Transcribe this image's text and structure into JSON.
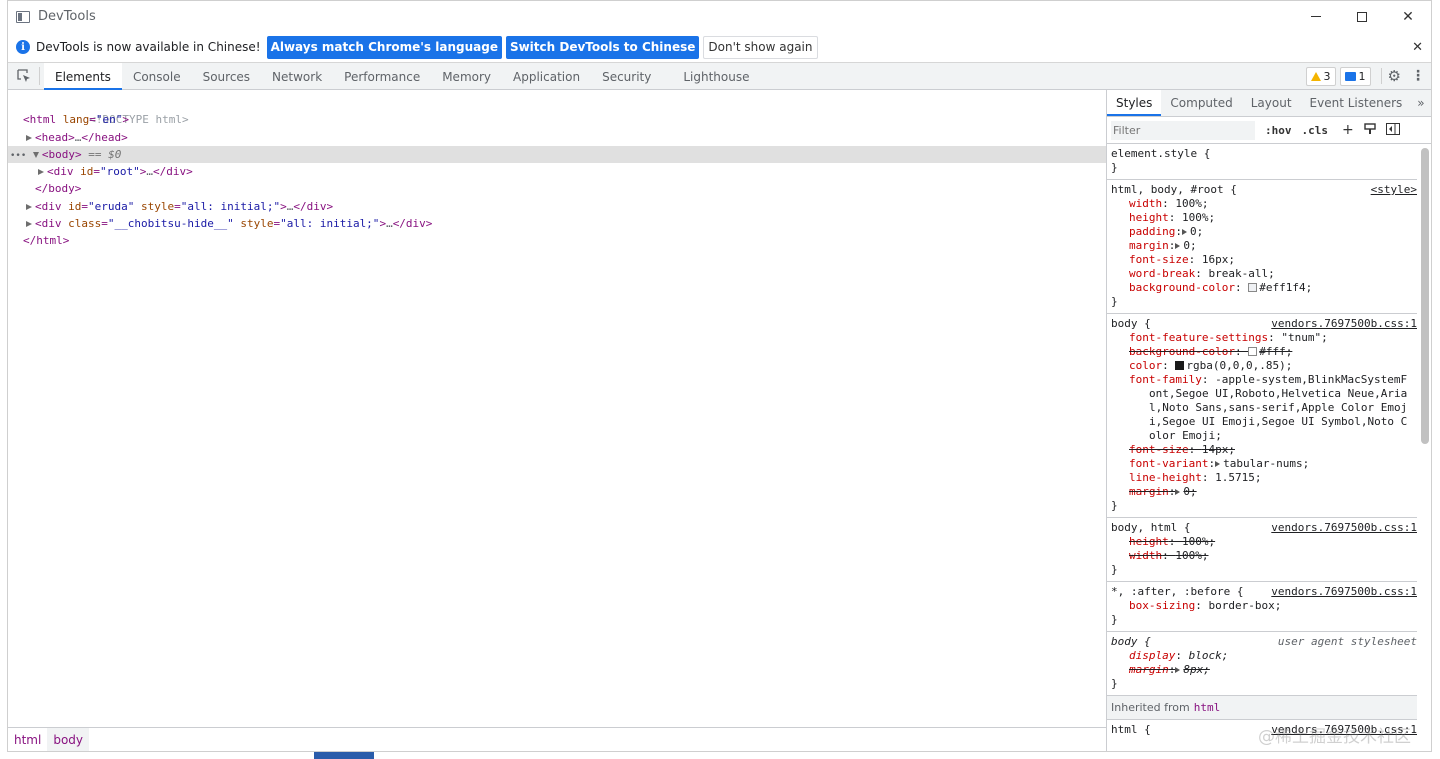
{
  "window": {
    "title": "DevTools",
    "minimize": "—",
    "maximize": "☐",
    "close": "✕"
  },
  "infobar": {
    "message": "DevTools is now available in Chinese!",
    "btn_match": "Always match Chrome's language",
    "btn_switch": "Switch DevTools to Chinese",
    "btn_dismiss": "Don't show again",
    "close": "✕"
  },
  "toolbar": {
    "tabs": [
      "Elements",
      "Console",
      "Sources",
      "Network",
      "Performance",
      "Memory",
      "Application",
      "Security",
      "Lighthouse"
    ],
    "active_tab": "Elements",
    "warnings_count": "3",
    "messages_count": "1"
  },
  "dom": {
    "doctype": "<!DOCTYPE html>",
    "html_open": "<html",
    "html_lang_attr": "lang",
    "html_lang_val": "\"en\"",
    "head": "<head>",
    "head_close": "</head>",
    "body_open": "<body>",
    "body_suffix": "== $0",
    "root_open": "<div",
    "root_id_attr": "id",
    "root_id_val": "\"root\"",
    "div_close": "</div>",
    "body_close": "</body>",
    "eruda_id_val": "\"eruda\"",
    "style_attr": "style",
    "style_val": "\"all: initial;\"",
    "class_attr": "class",
    "chobitsu_val": "\"__chobitsu-hide__\"",
    "html_close": "</html>",
    "ellipsis": "…",
    "dots": "•••"
  },
  "breadcrumbs": [
    "html",
    "body"
  ],
  "styles_tabs": {
    "items": [
      "Styles",
      "Computed",
      "Layout",
      "Event Listeners"
    ],
    "more": "»"
  },
  "filter": {
    "placeholder": "Filter",
    "hov": ":hov",
    "cls": ".cls",
    "plus": "+"
  },
  "rules": {
    "element_style": {
      "selector": "element.style {",
      "close": "}"
    },
    "r1": {
      "selector": "html, body, #root {",
      "source": "<style>",
      "decls": [
        {
          "p": "width",
          "v": "100%;"
        },
        {
          "p": "height",
          "v": "100%;"
        },
        {
          "p": "padding",
          "v": "0;"
        },
        {
          "p": "margin",
          "v": "0;"
        },
        {
          "p": "font-size",
          "v": "16px;"
        },
        {
          "p": "word-break",
          "v": "break-all;"
        },
        {
          "p": "background-color",
          "v": "#eff1f4;"
        }
      ],
      "swatch_color": "#eff1f4"
    },
    "r2": {
      "selector": "body {",
      "source": "vendors.7697500b.css:1",
      "decls": [
        {
          "p": "font-feature-settings",
          "v": "\"tnum\";"
        },
        {
          "p": "background-color",
          "v": "#fff;"
        },
        {
          "p": "color",
          "v": "rgba(0,0,0,.85);"
        },
        {
          "p": "font-family",
          "v": "-apple-system,BlinkMacSystemFont,Segoe UI,Roboto,Helvetica Neue,Arial,Noto Sans,sans-serif,Apple Color Emoji,Segoe UI Emoji,Segoe UI Symbol,Noto Color Emoji;"
        },
        {
          "p": "font-size",
          "v": "14px;"
        },
        {
          "p": "font-variant",
          "v": "tabular-nums;"
        },
        {
          "p": "line-height",
          "v": "1.5715;"
        },
        {
          "p": "margin",
          "v": "0;"
        }
      ]
    },
    "r3": {
      "selector": "body, html {",
      "source": "vendors.7697500b.css:1",
      "decls": [
        {
          "p": "height",
          "v": "100%;"
        },
        {
          "p": "width",
          "v": "100%;"
        }
      ]
    },
    "r4": {
      "selector": "*, :after, :before {",
      "source": "vendors.7697500b.css:1",
      "decls": [
        {
          "p": "box-sizing",
          "v": "border-box;"
        }
      ]
    },
    "r5": {
      "selector": "body {",
      "source": "user agent stylesheet",
      "decls": [
        {
          "p": "display",
          "v": "block;"
        },
        {
          "p": "margin",
          "v": "8px;"
        }
      ]
    },
    "inherited_label": "Inherited from",
    "inherited_tag": "html",
    "r6": {
      "selector": "html {",
      "source": "vendors.7697500b.css:1"
    },
    "close": "}"
  },
  "watermark": "@稀土掘金技术社区",
  "colors": {
    "accent": "#1a73e8",
    "tag": "#881280",
    "attr_name": "#994500",
    "attr_value": "#1a1aa6",
    "prop": "#c80000"
  }
}
